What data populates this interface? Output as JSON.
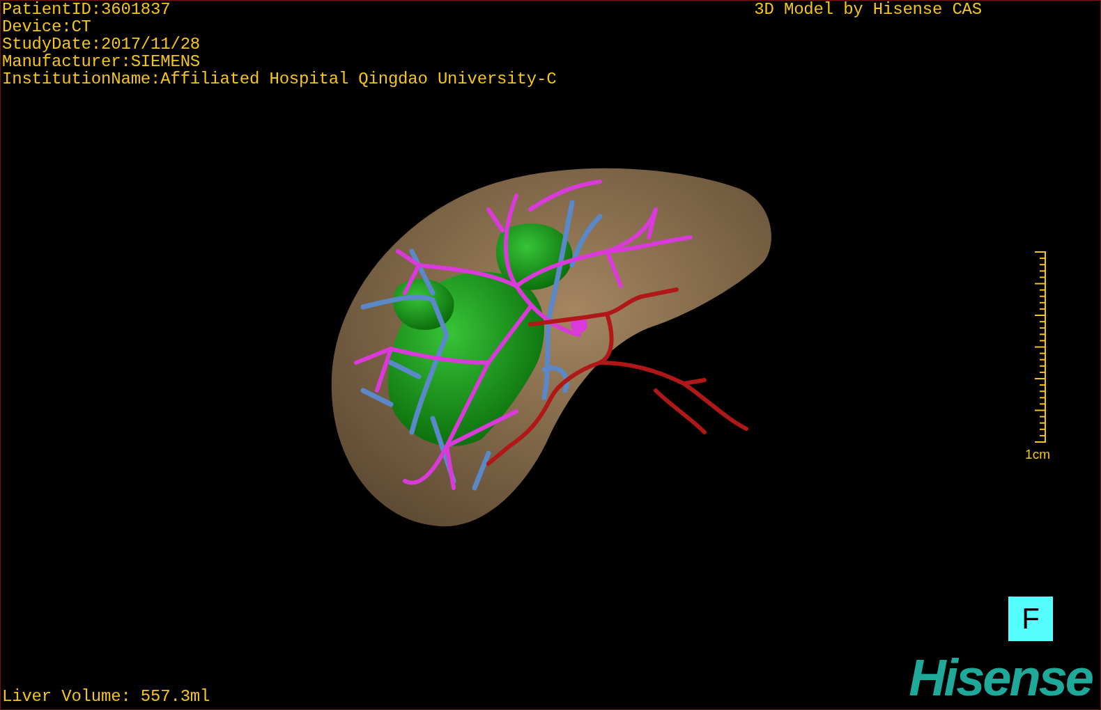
{
  "patient_info": [
    "PatientID:3601837",
    "Device:CT",
    "StudyDate:2017/11/28",
    "Manufacturer:SIEMENS",
    "InstitutionName:Affiliated Hospital Qingdao University-C"
  ],
  "viewer_title": "3D Model by Hisense CAS",
  "scale_bar": {
    "label": "1cm"
  },
  "liver_volume": "Liver Volume: 557.3ml",
  "orientation_button": "F",
  "logo": "Hisense"
}
